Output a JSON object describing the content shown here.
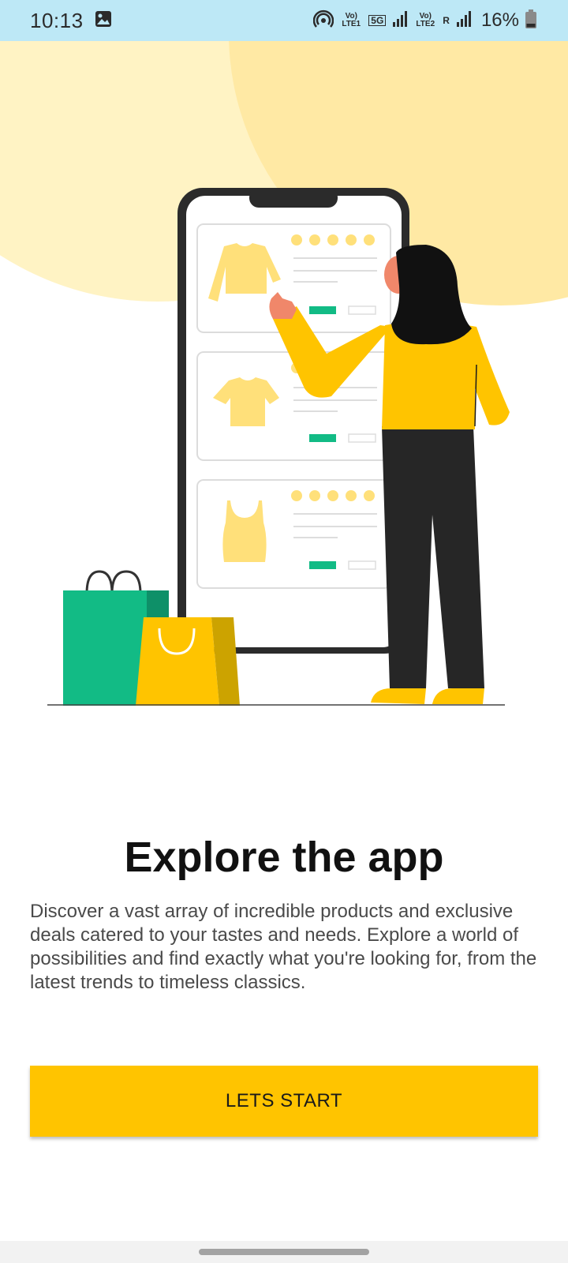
{
  "status_bar": {
    "time": "10:13",
    "network_lte1": "Vo) LTE1",
    "network_5g": "5G",
    "network_lte2": "Vo) LTE2",
    "roaming": "R",
    "battery_percent": "16%",
    "icons": [
      "gallery-icon",
      "hotspot-icon",
      "signal-icon",
      "battery-icon"
    ]
  },
  "onboarding": {
    "title": "Explore the app",
    "description": "Discover a vast array of incredible products and exclusive deals catered to your tastes and needs. Explore a world of possibilities and find exactly what you're looking for, from the latest trends to timeless classics.",
    "button_label": "LETS START"
  },
  "colors": {
    "status_bar_bg": "#bde8f6",
    "accent_yellow": "#ffc400",
    "illustration_green": "#12bb85",
    "soft_yellow": "#fff2c2"
  }
}
